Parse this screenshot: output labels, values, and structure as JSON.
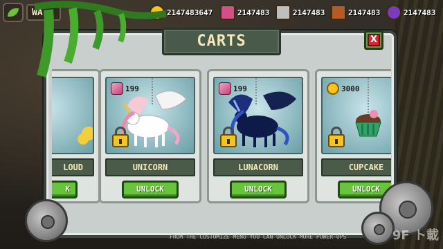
{
  "hud": {
    "title_partial": "WA",
    "currencies": [
      {
        "icon": "gold-coin-icon",
        "value": "2147483647",
        "color": "#f5c51c"
      },
      {
        "icon": "pink-gem-icon",
        "value": "2147483",
        "color": "#d24f8a"
      },
      {
        "icon": "tools-icon",
        "value": "2147483",
        "color": "#bfbfbf"
      },
      {
        "icon": "crate-icon",
        "value": "2147483",
        "color": "#b55a2a"
      },
      {
        "icon": "purple-orb-icon",
        "value": "2147483",
        "color": "#7a3bbf"
      }
    ]
  },
  "dialog": {
    "title": "CARTS",
    "close_label": "X"
  },
  "cards": [
    {
      "name": "LOUD",
      "price": "",
      "currency": "none",
      "button": "K",
      "partial": true
    },
    {
      "name": "UNICORN",
      "price": "199",
      "currency": "gem",
      "button": "UNLOCK"
    },
    {
      "name": "LUNACORN",
      "price": "199",
      "currency": "gem",
      "button": "UNLOCK"
    },
    {
      "name": "CUPCAKE",
      "price": "3000",
      "currency": "coin",
      "button": "UNLOCK"
    }
  ],
  "footer_text": "FROM THE CUSTOMIZE MENU YOU CAN UNLOCK MORE POWER-UPS",
  "watermark": "9F ト載",
  "colors": {
    "accent_green": "#68c43a",
    "panel": "#c9cfcc",
    "title_bg": "#4a5a4a"
  }
}
